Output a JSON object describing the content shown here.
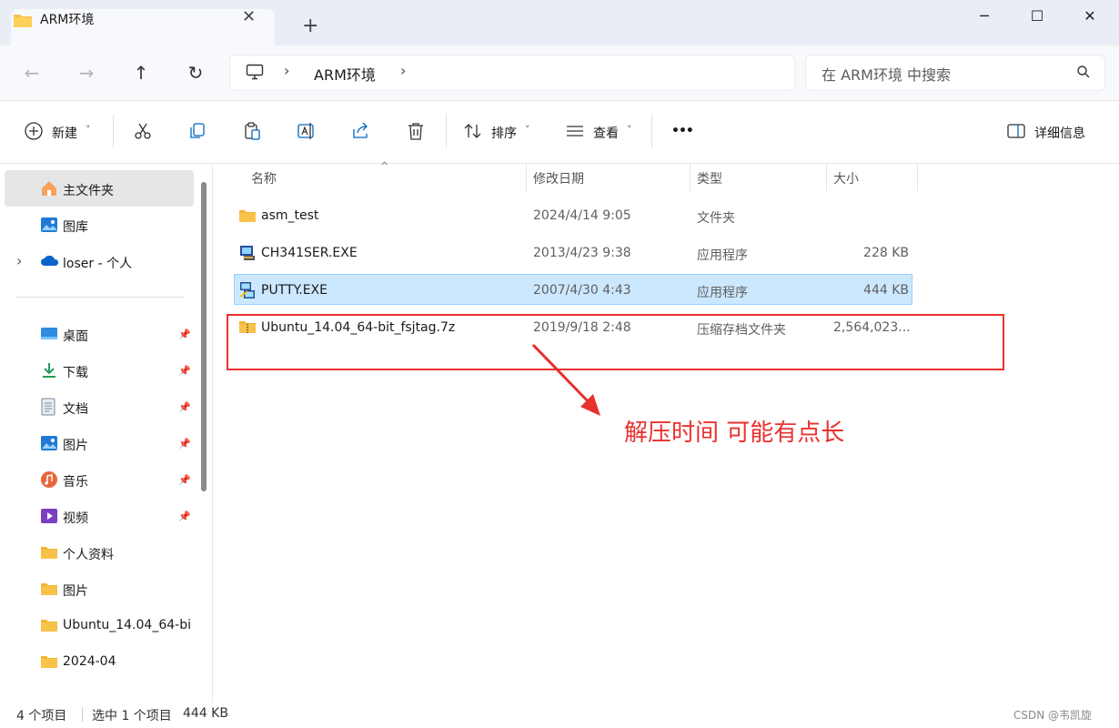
{
  "window": {
    "tab_title": "ARM环境",
    "new_tab": "+",
    "minimize": "─",
    "maximize": "☐",
    "close": "✕"
  },
  "nav": {
    "back": "←",
    "forward": "→",
    "up": "↑",
    "refresh": "↻"
  },
  "address": {
    "separator": "›",
    "path": "ARM环境"
  },
  "search": {
    "placeholder": "在 ARM环境 中搜索"
  },
  "toolbar": {
    "new_label": "新建",
    "sort_label": "排序",
    "view_label": "查看",
    "more_label": "•••",
    "details_label": "详细信息",
    "caret": "˅"
  },
  "sidebar": {
    "expander": "›",
    "pin": "📌",
    "items": [
      {
        "label": "主文件夹",
        "icon": "home-icon"
      },
      {
        "label": "图库",
        "icon": "gallery-icon"
      },
      {
        "label": "loser - 个人",
        "icon": "onedrive-icon"
      },
      {
        "label": "桌面",
        "icon": "desktop-icon"
      },
      {
        "label": "下载",
        "icon": "download-icon"
      },
      {
        "label": "文档",
        "icon": "document-icon"
      },
      {
        "label": "图片",
        "icon": "pictures-icon"
      },
      {
        "label": "音乐",
        "icon": "music-icon"
      },
      {
        "label": "视频",
        "icon": "video-icon"
      },
      {
        "label": "个人资料",
        "icon": "folder-icon"
      },
      {
        "label": "图片",
        "icon": "folder-icon"
      },
      {
        "label": "Ubuntu_14.04_64-bi",
        "icon": "folder-icon"
      },
      {
        "label": "2024-04",
        "icon": "folder-icon"
      }
    ]
  },
  "columns": {
    "name": "名称",
    "modified": "修改日期",
    "type": "类型",
    "size": "大小",
    "sort_indicator": "^"
  },
  "files": [
    {
      "name": "asm_test",
      "modified": "2024/4/14 9:05",
      "type": "文件夹",
      "size": "",
      "icon": "folder-icon"
    },
    {
      "name": "CH341SER.EXE",
      "modified": "2013/4/23 9:38",
      "type": "应用程序",
      "size": "228 KB",
      "icon": "exe-icon"
    },
    {
      "name": "PUTTY.EXE",
      "modified": "2007/4/30 4:43",
      "type": "应用程序",
      "size": "444 KB",
      "icon": "putty-icon",
      "selected": true
    },
    {
      "name": "Ubuntu_14.04_64-bit_fsjtag.7z",
      "modified": "2019/9/18 2:48",
      "type": "压缩存档文件夹",
      "size": "2,564,023...",
      "icon": "archive-icon"
    }
  ],
  "annotation": {
    "text": "解压时间 可能有点长",
    "color": "#e8312f"
  },
  "status": {
    "count": "4 个项目",
    "selection": "选中 1 个项目",
    "selection_size": "444 KB"
  },
  "watermark": "CSDN @韦凯旋",
  "colors": {
    "accent": "#0067c0",
    "selection": "#cce8ff",
    "folder": "#f8c24a"
  }
}
